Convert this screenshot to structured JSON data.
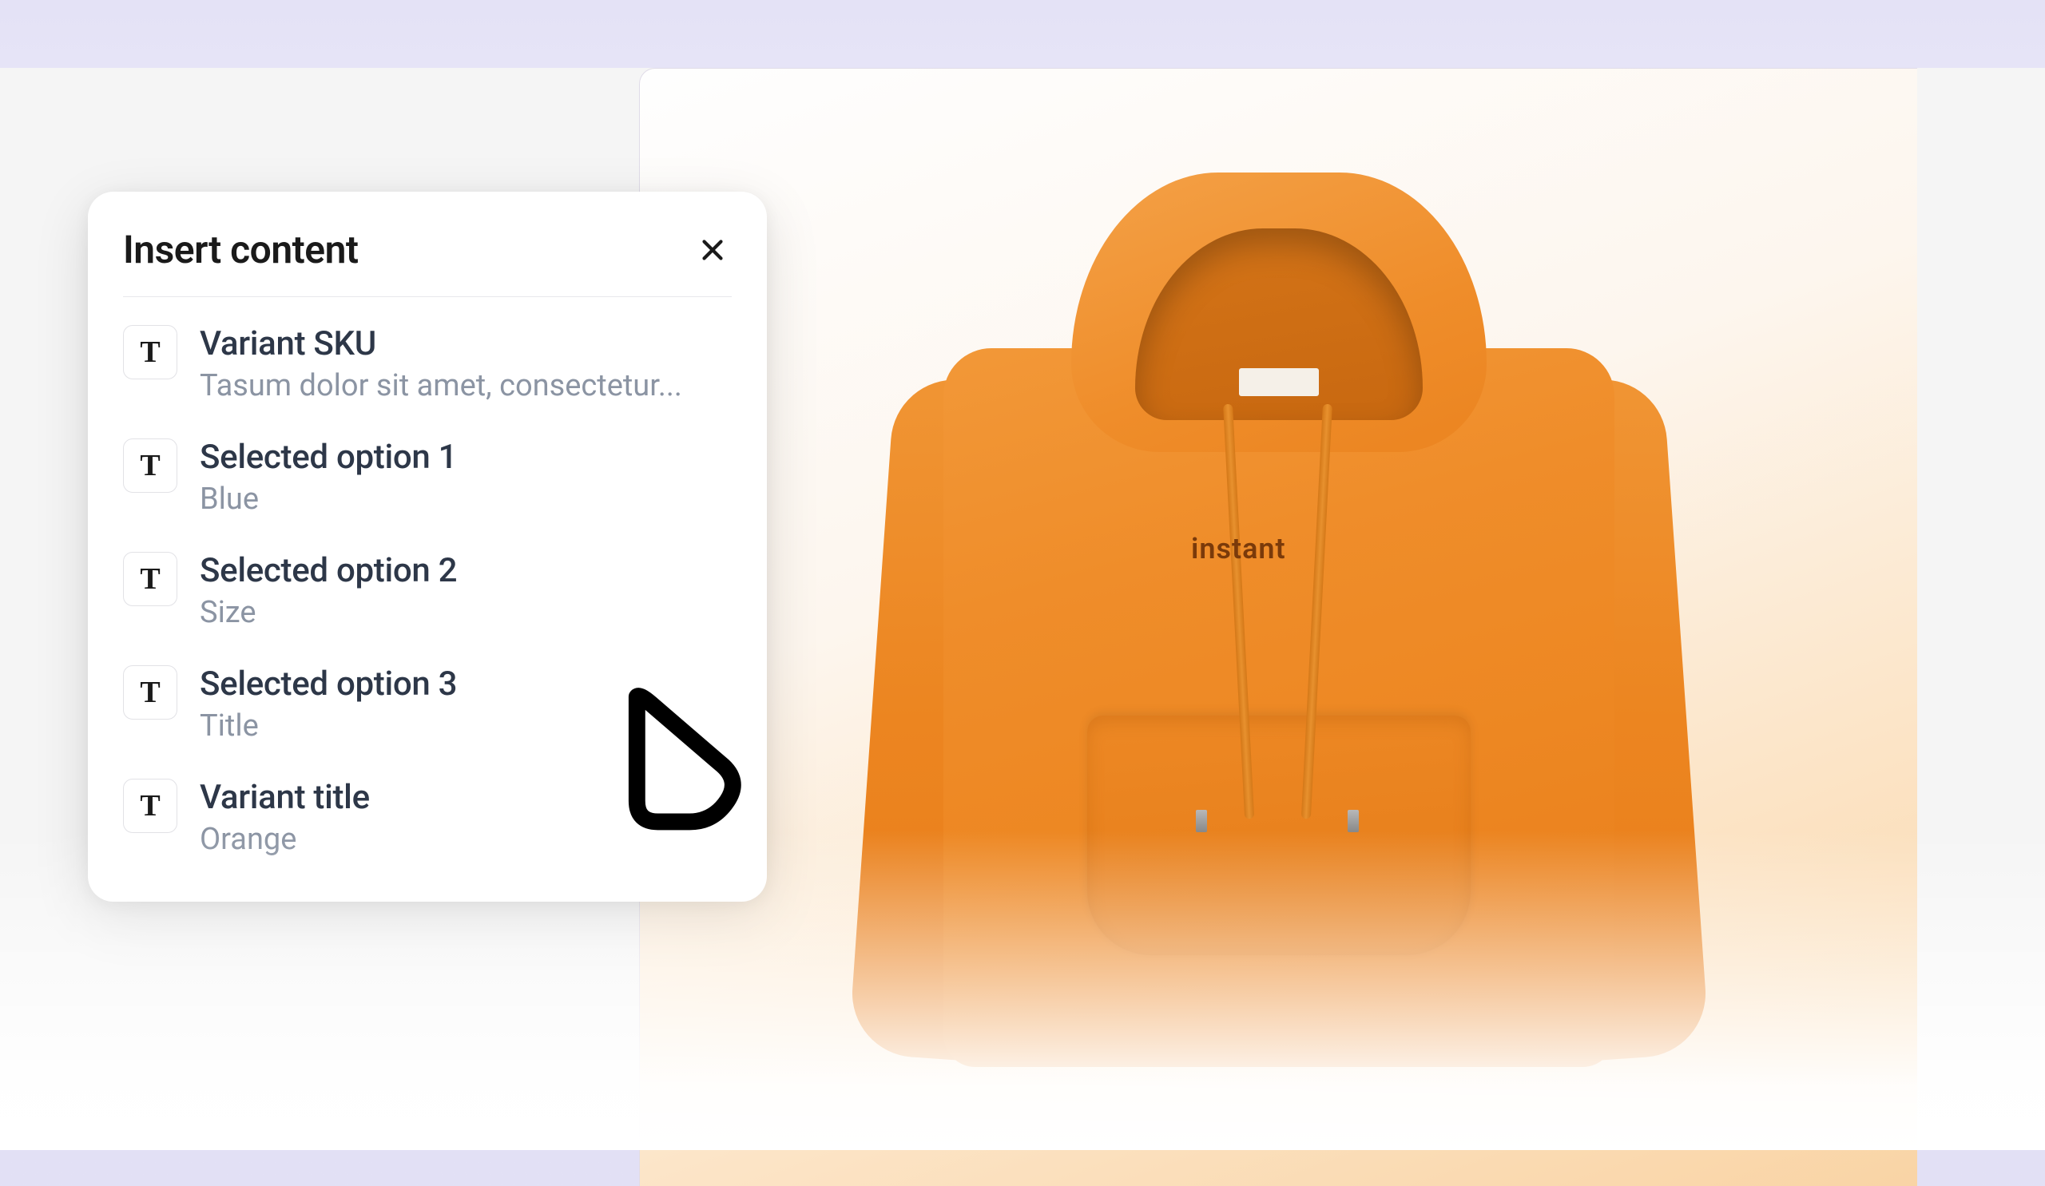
{
  "popup": {
    "title": "Insert content",
    "items": [
      {
        "title": "Variant SKU",
        "subtitle": "Tasum dolor sit amet, consectetur..."
      },
      {
        "title": "Selected option 1",
        "subtitle": "Blue"
      },
      {
        "title": "Selected option 2",
        "subtitle": "Size"
      },
      {
        "title": "Selected option 3",
        "subtitle": "Title"
      },
      {
        "title": "Variant title",
        "subtitle": "Orange"
      }
    ]
  },
  "product": {
    "logo_text": "instant"
  },
  "icons": {
    "text_glyph": "T"
  }
}
